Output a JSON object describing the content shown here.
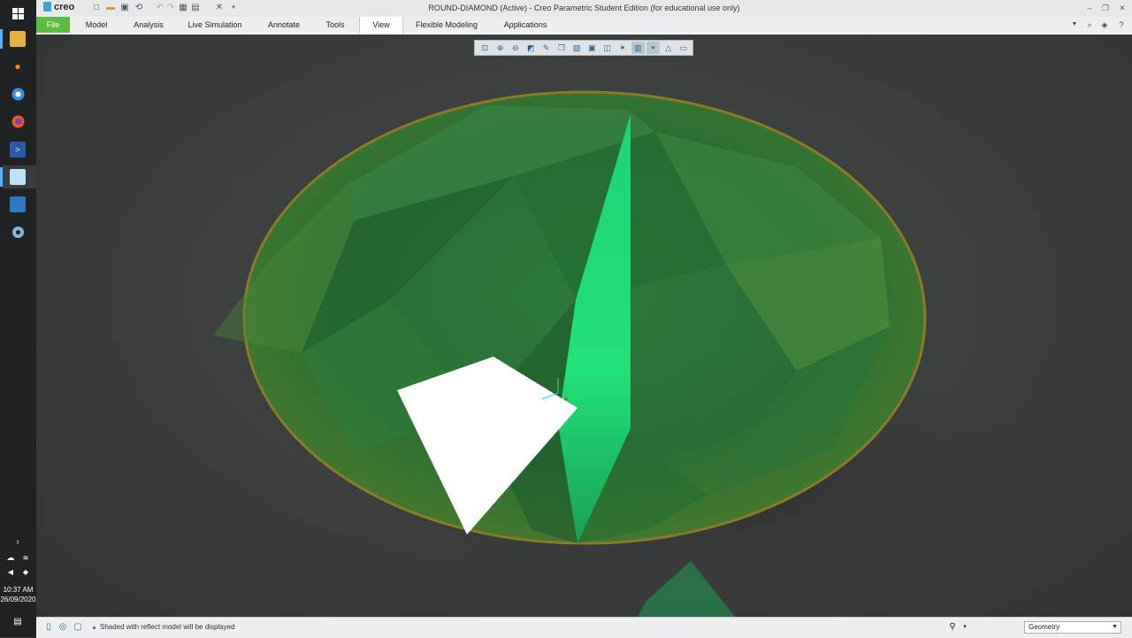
{
  "window": {
    "title": "ROUND-DIAMOND (Active) - Creo Parametric Student Edition (for educational use only)",
    "app_logo": "creo"
  },
  "ribbon": {
    "tabs": [
      {
        "label": "File"
      },
      {
        "label": "Model"
      },
      {
        "label": "Analysis"
      },
      {
        "label": "Live Simulation"
      },
      {
        "label": "Annotate"
      },
      {
        "label": "Tools"
      },
      {
        "label": "View"
      },
      {
        "label": "Flexible Modeling"
      },
      {
        "label": "Applications"
      }
    ],
    "active_tab": "View"
  },
  "taskbar": {
    "time": "10:37 AM",
    "date": "26/09/2020"
  },
  "status": {
    "message": "Shaded with reflect model will be displayed",
    "filter_value": "Geometry"
  },
  "colors": {
    "file_tab": "#5dbb3f",
    "gem_green": "#2f7a3a",
    "highlight_face": "#22e07a"
  }
}
